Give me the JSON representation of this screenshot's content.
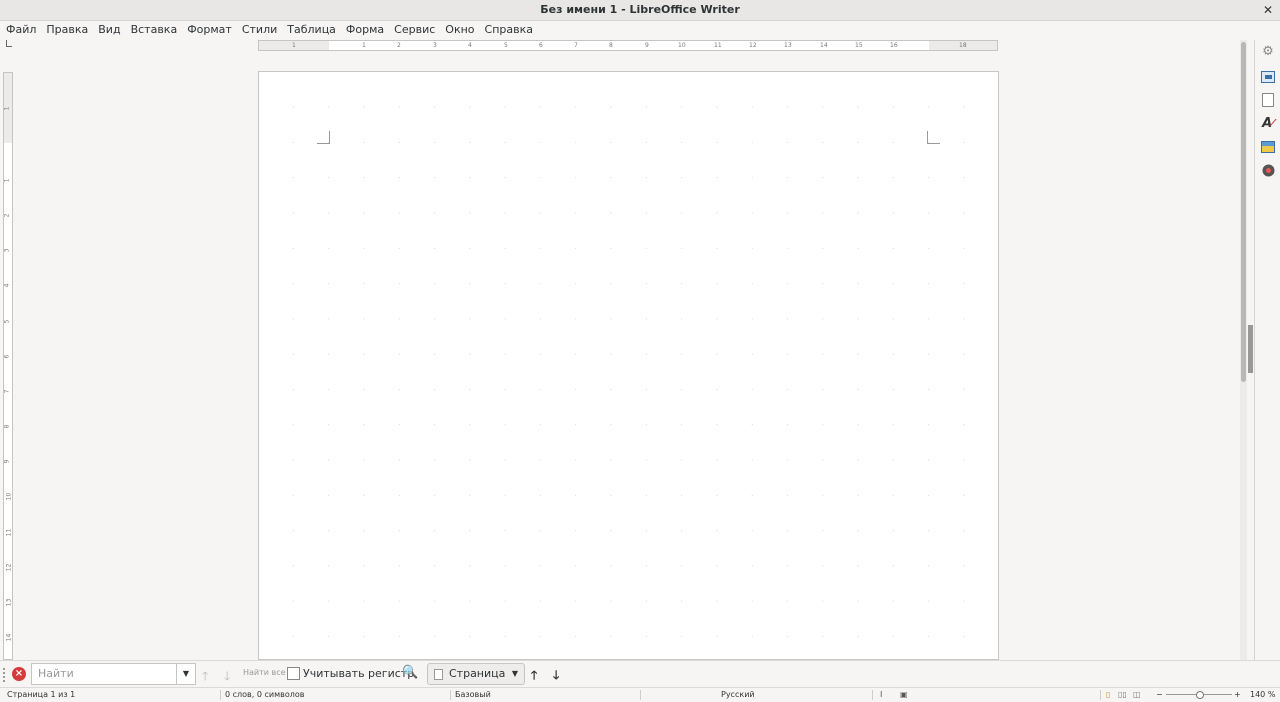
{
  "window": {
    "title": "Без имени 1 - LibreOffice Writer",
    "close_glyph": "✕"
  },
  "menu": [
    "Файл",
    "Правка",
    "Вид",
    "Вставка",
    "Формат",
    "Стили",
    "Таблица",
    "Форма",
    "Сервис",
    "Окно",
    "Справка"
  ],
  "ruler": {
    "h_left_numbers": [
      "1"
    ],
    "h_numbers": [
      "1",
      "2",
      "3",
      "4",
      "5",
      "6",
      "7",
      "8",
      "9",
      "10",
      "11",
      "12",
      "13",
      "14",
      "15",
      "16"
    ],
    "h_right_numbers": [
      "18"
    ],
    "v_numbers": [
      "1",
      "1",
      "2",
      "3",
      "4",
      "5",
      "6",
      "7",
      "8",
      "9",
      "10",
      "11",
      "12",
      "13",
      "14"
    ]
  },
  "sidebar_icons": [
    "properties-icon",
    "page-icon",
    "styles-icon",
    "gallery-icon",
    "navigator-icon"
  ],
  "findbar": {
    "placeholder": "Найти",
    "find_all": "Найти все",
    "match_case": "Учитывать регистр",
    "search_type": "Страница"
  },
  "status": {
    "page": "Страница 1 из 1",
    "words": "0 слов, 0 символов",
    "style": "Базовый",
    "language": "Русский",
    "zoom_minus": "−",
    "zoom_plus": "+",
    "zoom": "140 %"
  }
}
